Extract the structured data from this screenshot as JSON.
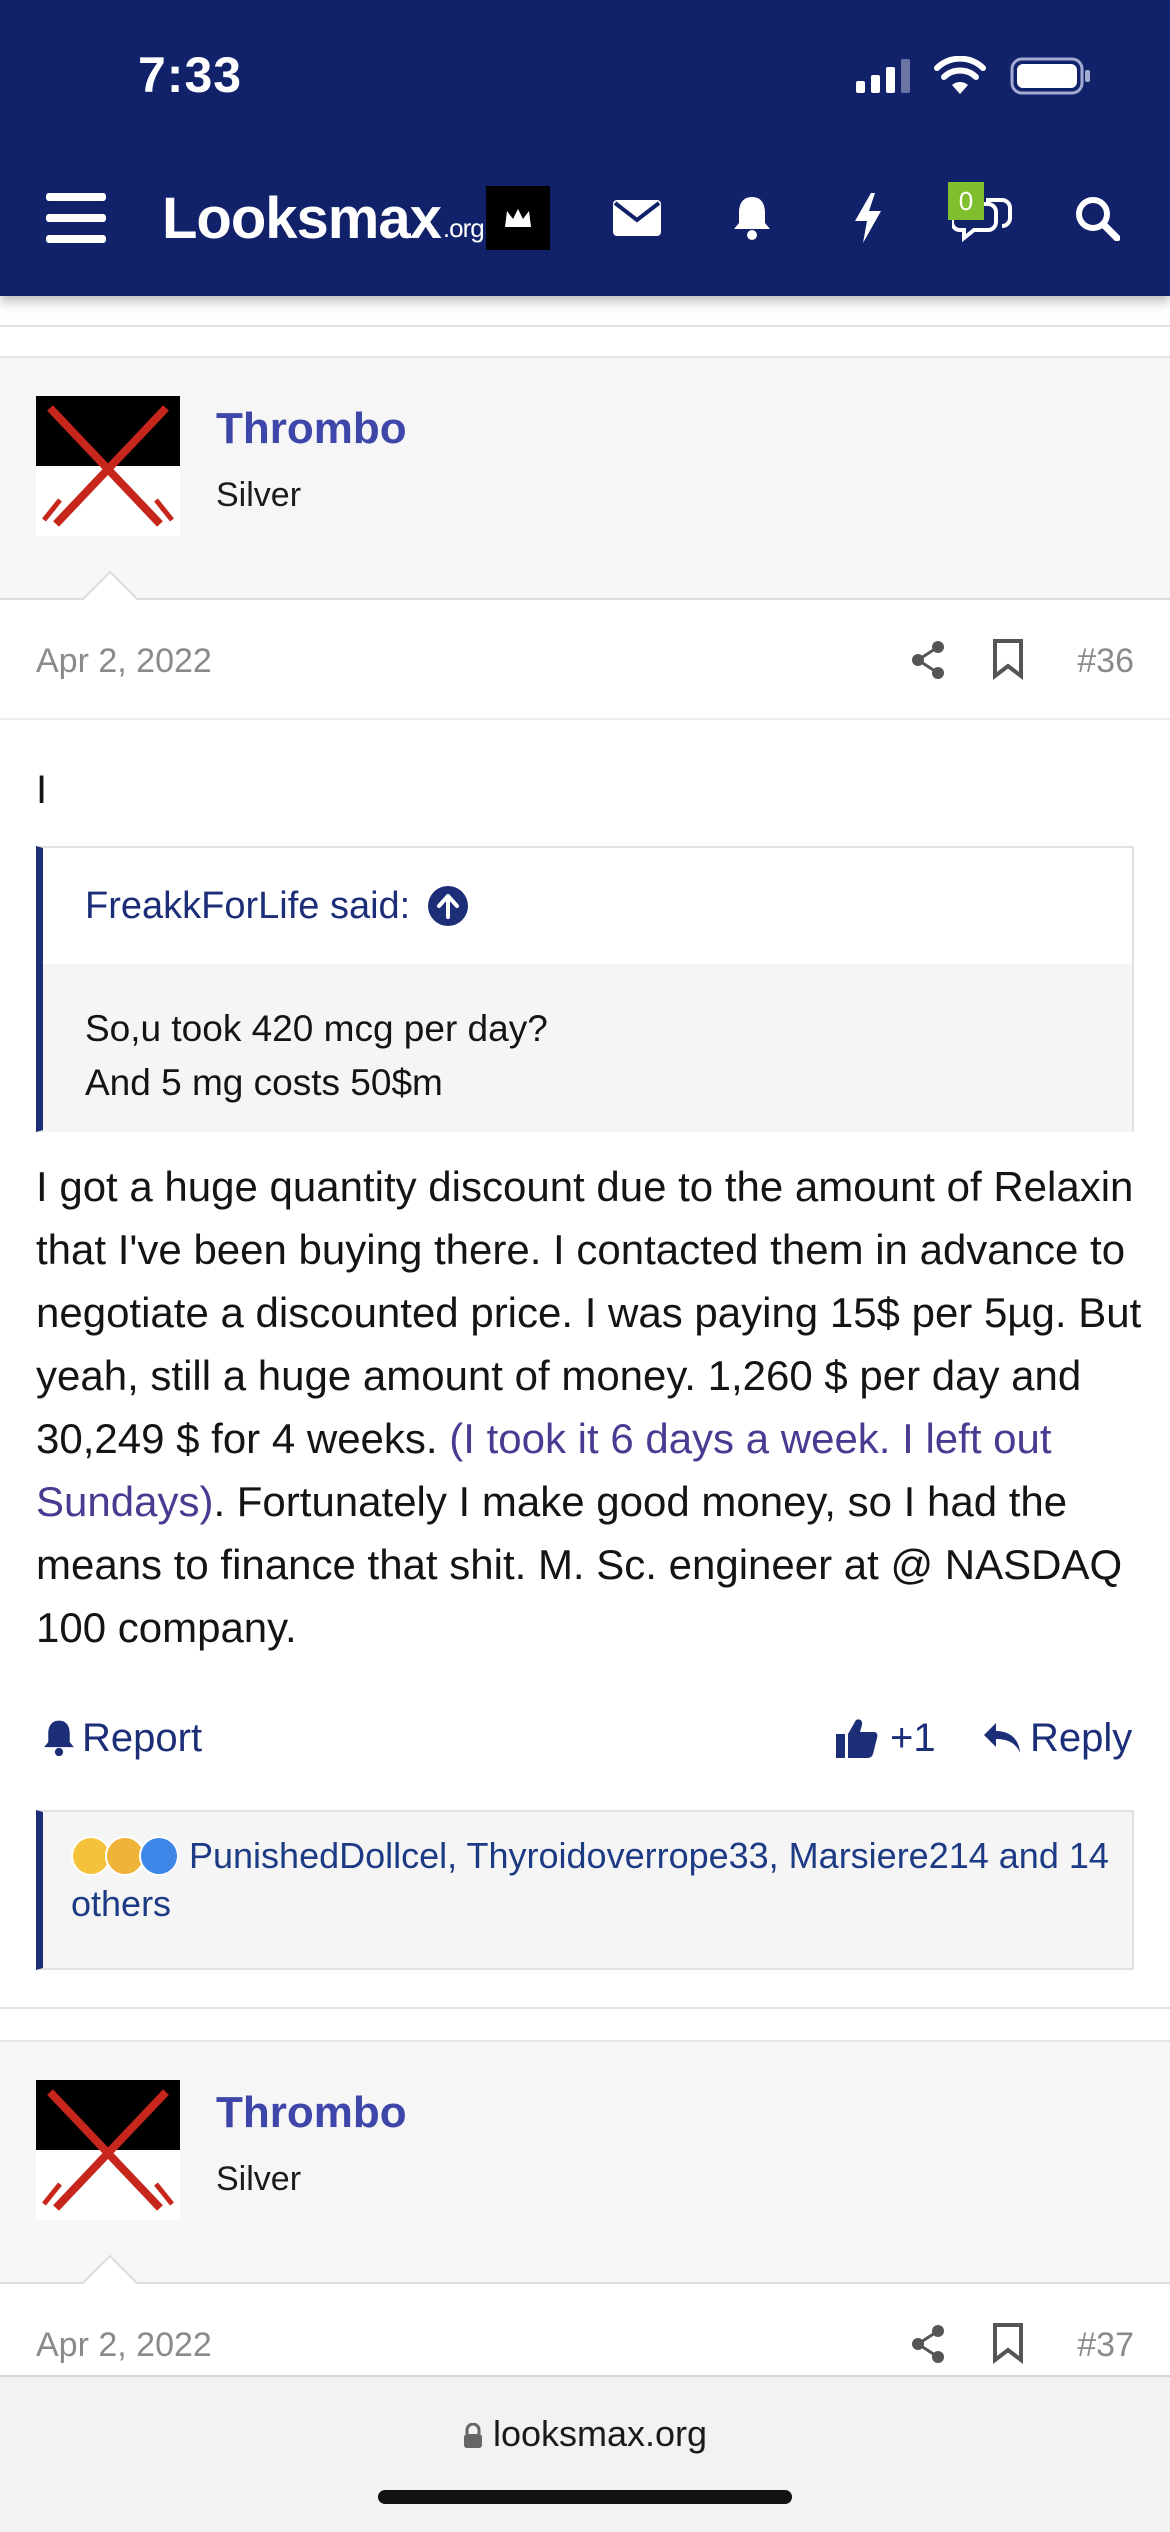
{
  "status_bar": {
    "time": "7:33"
  },
  "nav": {
    "logo_main": "Looksmax",
    "logo_suffix": ".org",
    "chat_count": "0"
  },
  "posts": [
    {
      "author": "Thrombo",
      "rank": "Silver",
      "date": "Apr 2, 2022",
      "number": "#36",
      "first_line": "I",
      "quote": {
        "author_label": "FreakkForLife said:",
        "lines": [
          "So,u took 420 mcg per day?",
          "And 5 mg costs 50$m"
        ]
      },
      "body_part1": "I got a huge quantity discount due to the amount of Relaxin that I've been buying there. I contacted them in advance to negotiate a discounted price. I was paying 15$ per 5µg. But yeah, still a huge amount of money. 1,260 $ per day and 30,249 $ for 4 weeks. ",
      "body_link": "(I took it 6 days a week. I left out Sundays)",
      "body_part2": ". Fortunately I make good money, so I had the means to finance that shit. M. Sc. engineer at @ NASDAQ 100 company.",
      "actions": {
        "report": "Report",
        "like_count": "+1",
        "reply": "Reply"
      },
      "reactions_text": "PunishedDollcel, Thyroidoverrope33, Marsiere214 and 14 others"
    },
    {
      "author": "Thrombo",
      "rank": "Silver",
      "date": "Apr 2, 2022",
      "number": "#37"
    }
  ],
  "browser": {
    "url": "looksmax.org"
  },
  "colors": {
    "nav_bg": "#11216a",
    "link": "#3e47a9",
    "quote_accent": "#1d2e78",
    "badge": "#7fbf2e"
  }
}
